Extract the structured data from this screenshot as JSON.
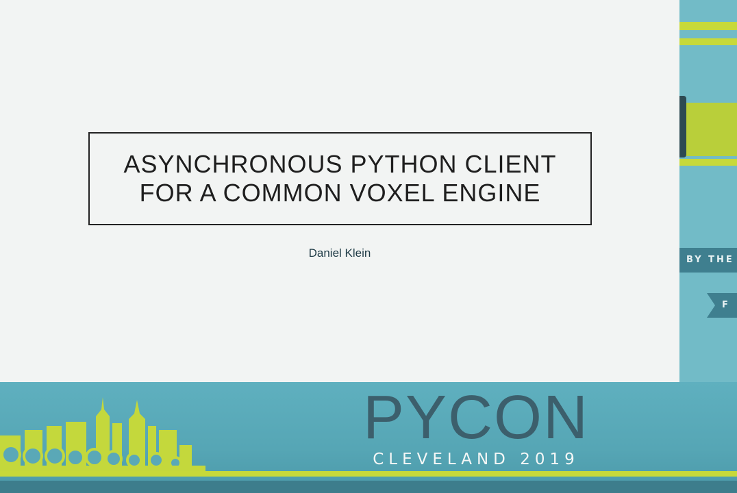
{
  "slide": {
    "title_line1": "ASYNCHRONOUS PYTHON CLIENT",
    "title_line2": "FOR A COMMON VOXEL ENGINE",
    "author": "Daniel Klein"
  },
  "banner": {
    "by_the_text": "BY THE",
    "ribbon_text": "F",
    "logo_main": "PYCON",
    "logo_sub": "CLEVELAND 2019"
  },
  "colors": {
    "slide_bg": "#f2f4f3",
    "teal": "#5aa8b7",
    "lime": "#c7d93a",
    "dark_teal": "#3f7f8f",
    "logo_text": "#3c5f6c"
  }
}
